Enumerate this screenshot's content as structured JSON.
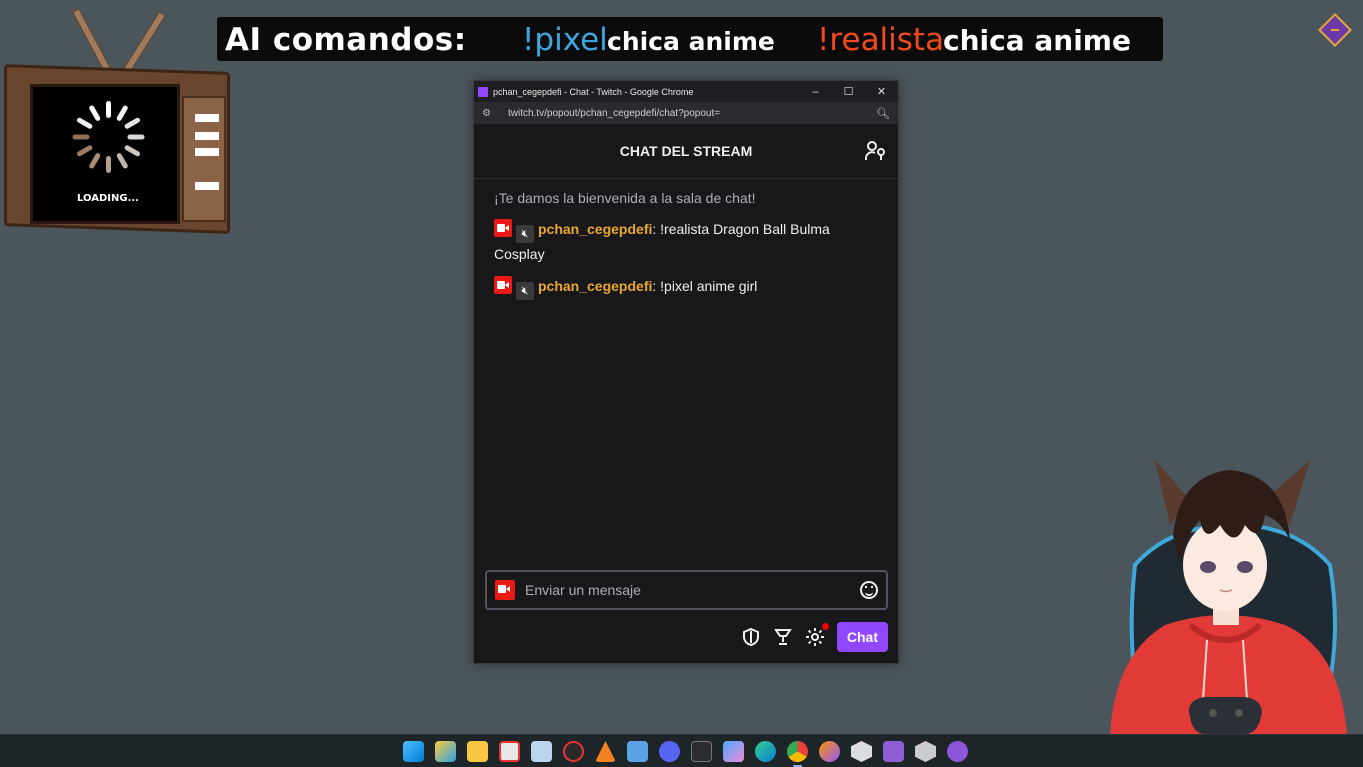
{
  "banner": {
    "title": "AI comandos:",
    "command1": "!pixel",
    "text1": "chica anime",
    "command2": "!realista",
    "text2": "chica anime"
  },
  "tv": {
    "loading_text": "LOADING..."
  },
  "window": {
    "title": "pchan_cegepdefi - Chat - Twitch - Google Chrome",
    "controls": {
      "minimize": "–",
      "maximize": "☐",
      "close": "✕"
    },
    "url": "twitch.tv/popout/pchan_cegepdefi/chat?popout=",
    "zoom_icon": "zoom-icon"
  },
  "chat": {
    "header": "CHAT DEL STREAM",
    "welcome": "¡Te damos la bienvenida a la sala de chat!",
    "messages": [
      {
        "user": "pchan_cegepdefi",
        "text": ": !realista Dragon Ball Bulma Cosplay"
      },
      {
        "user": "pchan_cegepdefi",
        "text": ": !pixel anime girl"
      }
    ],
    "input_placeholder": "Enviar un mensaje",
    "send_label": "Chat"
  },
  "colors": {
    "twitch_purple": "#9147ff",
    "username": "#e8a731",
    "pixel_cmd": "#3aa7e0",
    "realista_cmd": "#f24a1d",
    "badge_red": "#e91916"
  },
  "taskbar": {
    "apps": [
      "windows-start",
      "mail",
      "file-explorer",
      "snipping-tool",
      "vs-code",
      "davinci",
      "vlc",
      "notepad",
      "discord",
      "terminal",
      "copilot",
      "edge",
      "chrome",
      "firefox",
      "unity",
      "visual-studio",
      "game-app",
      "github-desktop"
    ]
  }
}
